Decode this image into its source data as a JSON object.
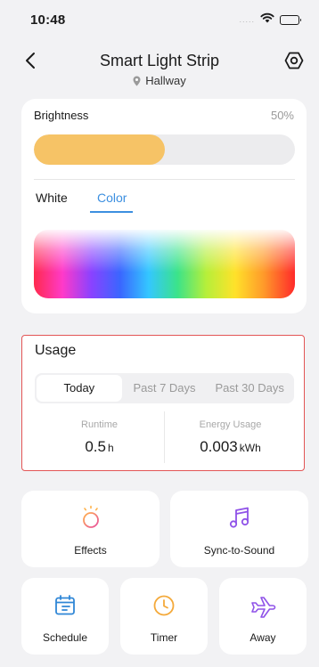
{
  "status_bar": {
    "time": "10:48",
    "signal_dots": "....."
  },
  "header": {
    "title": "Smart Light Strip",
    "location": "Hallway"
  },
  "brightness": {
    "label": "Brightness",
    "value_text": "50%",
    "level_percent": 50
  },
  "light_mode_tabs": [
    {
      "label": "White",
      "active": false
    },
    {
      "label": "Color",
      "active": true
    }
  ],
  "usage": {
    "title": "Usage",
    "periods": [
      {
        "label": "Today",
        "active": true
      },
      {
        "label": "Past 7 Days",
        "active": false
      },
      {
        "label": "Past 30 Days",
        "active": false
      }
    ],
    "runtime": {
      "label": "Runtime",
      "value": "0.5",
      "unit": "h"
    },
    "energy": {
      "label": "Energy Usage",
      "value": "0.003",
      "unit": "kWh"
    }
  },
  "features": {
    "effects": {
      "label": "Effects",
      "icon": "effects-icon"
    },
    "sync": {
      "label": "Sync-to-Sound",
      "icon": "music-note-icon"
    },
    "schedule": {
      "label": "Schedule",
      "icon": "calendar-icon"
    },
    "timer": {
      "label": "Timer",
      "icon": "clock-icon"
    },
    "away": {
      "label": "Away",
      "icon": "airplane-icon"
    }
  },
  "colors": {
    "accent_blue": "#3c8fe0",
    "brightness_fill": "#f6c366",
    "effects_icon": "#f5a623",
    "purple_icon": "#8f52e8",
    "schedule_icon": "#2f86d6",
    "timer_icon": "#f4a93a",
    "highlight_border": "#e35555"
  }
}
